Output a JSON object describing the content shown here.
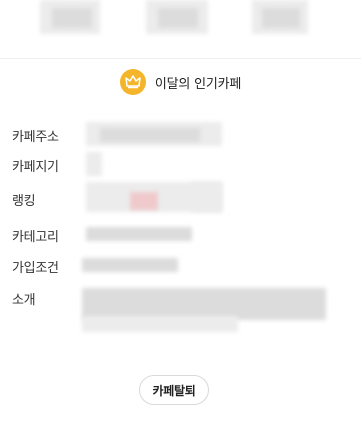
{
  "popular_banner": {
    "icon": "crown-icon",
    "title": "이달의 인기카페",
    "accent_color": "#f5b52a"
  },
  "cafe_info": {
    "labels": {
      "cafe_name": "카페주소",
      "cafe_manager": "카페지기",
      "ranking": "랭킹",
      "category": "카테고리",
      "join_condition": "가입조건",
      "description": "소개"
    }
  },
  "actions": {
    "leave_cafe_label": "카페탈퇴"
  }
}
